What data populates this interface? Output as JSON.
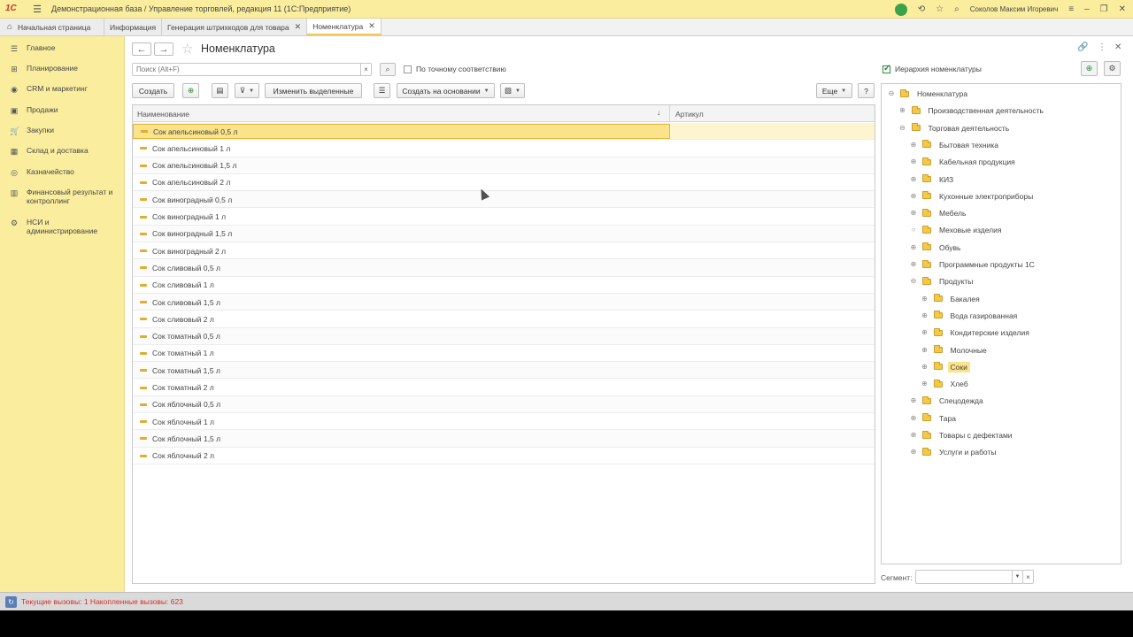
{
  "window": {
    "title": "Демонстрационная база / Управление торговлей, редакция 11  (1С:Предприятие)",
    "logo": "1С",
    "user": "Соколов Максим Игоревич"
  },
  "tabs": [
    {
      "label": "Начальная страница"
    },
    {
      "label": "Информация"
    },
    {
      "label": "Генерация штрихкодов для товара"
    },
    {
      "label": "Номенклатура"
    }
  ],
  "sidebar": {
    "items": [
      {
        "label": "Главное",
        "icon": "menu-icon"
      },
      {
        "label": "Планирование",
        "icon": "planning-icon"
      },
      {
        "label": "CRM и маркетинг",
        "icon": "crm-icon"
      },
      {
        "label": "Продажи",
        "icon": "sales-icon"
      },
      {
        "label": "Закупки",
        "icon": "purchases-icon"
      },
      {
        "label": "Склад и доставка",
        "icon": "warehouse-icon"
      },
      {
        "label": "Казначейство",
        "icon": "treasury-icon"
      },
      {
        "label": "Финансовый результат и контроллинг",
        "icon": "finance-icon"
      },
      {
        "label": "НСИ и администрирование",
        "icon": "gear-icon"
      }
    ]
  },
  "page": {
    "title": "Номенклатура"
  },
  "search": {
    "placeholder": "Поиск (Alt+F)",
    "exact_match_label": "По точному соответствию"
  },
  "toolbar": {
    "create_label": "Создать",
    "edit_selected_label": "Изменить выделенные",
    "create_based_on_label": "Создать на основании",
    "more_label": "Еще",
    "help_label": "?"
  },
  "grid": {
    "col_name": "Наименование",
    "col_article": "Артикул",
    "rows": [
      "Сок апельсиновый 0,5 л",
      "Сок апельсиновый 1 л",
      "Сок апельсиновый 1,5 л",
      "Сок апельсиновый 2 л",
      "Сок виноградный 0,5 л",
      "Сок виноградный 1 л",
      "Сок виноградный 1,5 л",
      "Сок виноградный 2 л",
      "Сок сливовый 0,5 л",
      "Сок сливовый 1 л",
      "Сок сливовый 1,5 л",
      "Сок сливовый 2 л",
      "Сок томатный 0,5 л",
      "Сок томатный 1 л",
      "Сок томатный 1,5 л",
      "Сок томатный 2 л",
      "Сок яблочный 0,5 л",
      "Сок яблочный 1 л",
      "Сок яблочный 1,5 л",
      "Сок яблочный 2 л"
    ],
    "selected_index": 0
  },
  "hierarchy": {
    "checkbox_label": "Иерархия номенклатуры",
    "nodes": [
      {
        "label": "Номенклатура",
        "level": 0,
        "toggle": "⊖"
      },
      {
        "label": "Производственная деятельность",
        "level": 1,
        "toggle": "⊕"
      },
      {
        "label": "Торговая деятельность",
        "level": 1,
        "toggle": "⊖"
      },
      {
        "label": "Бытовая техника",
        "level": 2,
        "toggle": "⊕"
      },
      {
        "label": "Кабельная продукция",
        "level": 2,
        "toggle": "⊕"
      },
      {
        "label": "КИЗ",
        "level": 2,
        "toggle": "⊕"
      },
      {
        "label": "Кухонные электроприборы",
        "level": 2,
        "toggle": "⊕"
      },
      {
        "label": "Мебель",
        "level": 2,
        "toggle": "⊕"
      },
      {
        "label": "Меховые изделия",
        "level": 2,
        "toggle": "○"
      },
      {
        "label": "Обувь",
        "level": 2,
        "toggle": "⊕"
      },
      {
        "label": "Программные продукты 1С",
        "level": 2,
        "toggle": "⊕"
      },
      {
        "label": "Продукты",
        "level": 2,
        "toggle": "⊖"
      },
      {
        "label": "Бакалея",
        "level": 3,
        "toggle": "⊕"
      },
      {
        "label": "Вода газированная",
        "level": 3,
        "toggle": "⊕"
      },
      {
        "label": "Кондитерские изделия",
        "level": 3,
        "toggle": "⊕"
      },
      {
        "label": "Молочные",
        "level": 3,
        "toggle": "⊕"
      },
      {
        "label": "Соки",
        "level": 3,
        "toggle": "⊕",
        "selected": true
      },
      {
        "label": "Хлеб",
        "level": 3,
        "toggle": "⊕"
      },
      {
        "label": "Спецодежда",
        "level": 2,
        "toggle": "⊕"
      },
      {
        "label": "Тара",
        "level": 2,
        "toggle": "⊕"
      },
      {
        "label": "Товары с дефектами",
        "level": 2,
        "toggle": "⊕"
      },
      {
        "label": "Услуги и работы",
        "level": 2,
        "toggle": "⊕"
      }
    ]
  },
  "segment": {
    "label": "Сегмент:"
  },
  "status": {
    "text": "Текущие вызовы: 1    Накопленные вызовы: 623"
  },
  "colors": {
    "accent_yellow": "#fbed9e",
    "selection": "#fbe38b",
    "status_red": "#d0332a"
  }
}
